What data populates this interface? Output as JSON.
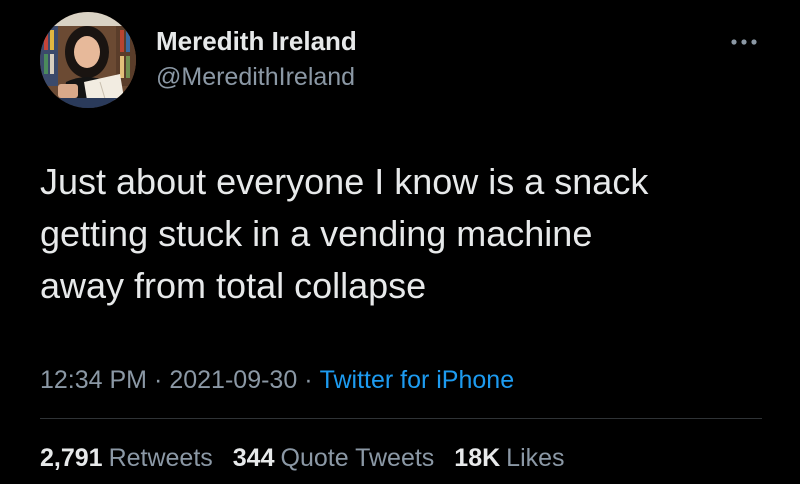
{
  "author": {
    "display_name": "Meredith Ireland",
    "handle": "@MeredithIreland",
    "avatar_icon": "profile-photo"
  },
  "more_icon": "ellipsis-icon",
  "tweet": {
    "lines": [
      "Just about everyone I know is a snack",
      "getting stuck in a vending machine",
      "away from total collapse"
    ]
  },
  "meta": {
    "time": "12:34 PM",
    "date": "2021-09-30",
    "separator": "·",
    "source": "Twitter for iPhone"
  },
  "stats": {
    "retweets_count": "2,791",
    "retweets_label": "Retweets",
    "quotes_count": "344",
    "quotes_label": "Quote Tweets",
    "likes_count": "18K",
    "likes_label": "Likes"
  },
  "colors": {
    "background": "#000000",
    "text_primary": "#e7e9ea",
    "text_secondary": "#8b98a5",
    "link": "#1d9bf0",
    "divider": "#2f3336"
  }
}
